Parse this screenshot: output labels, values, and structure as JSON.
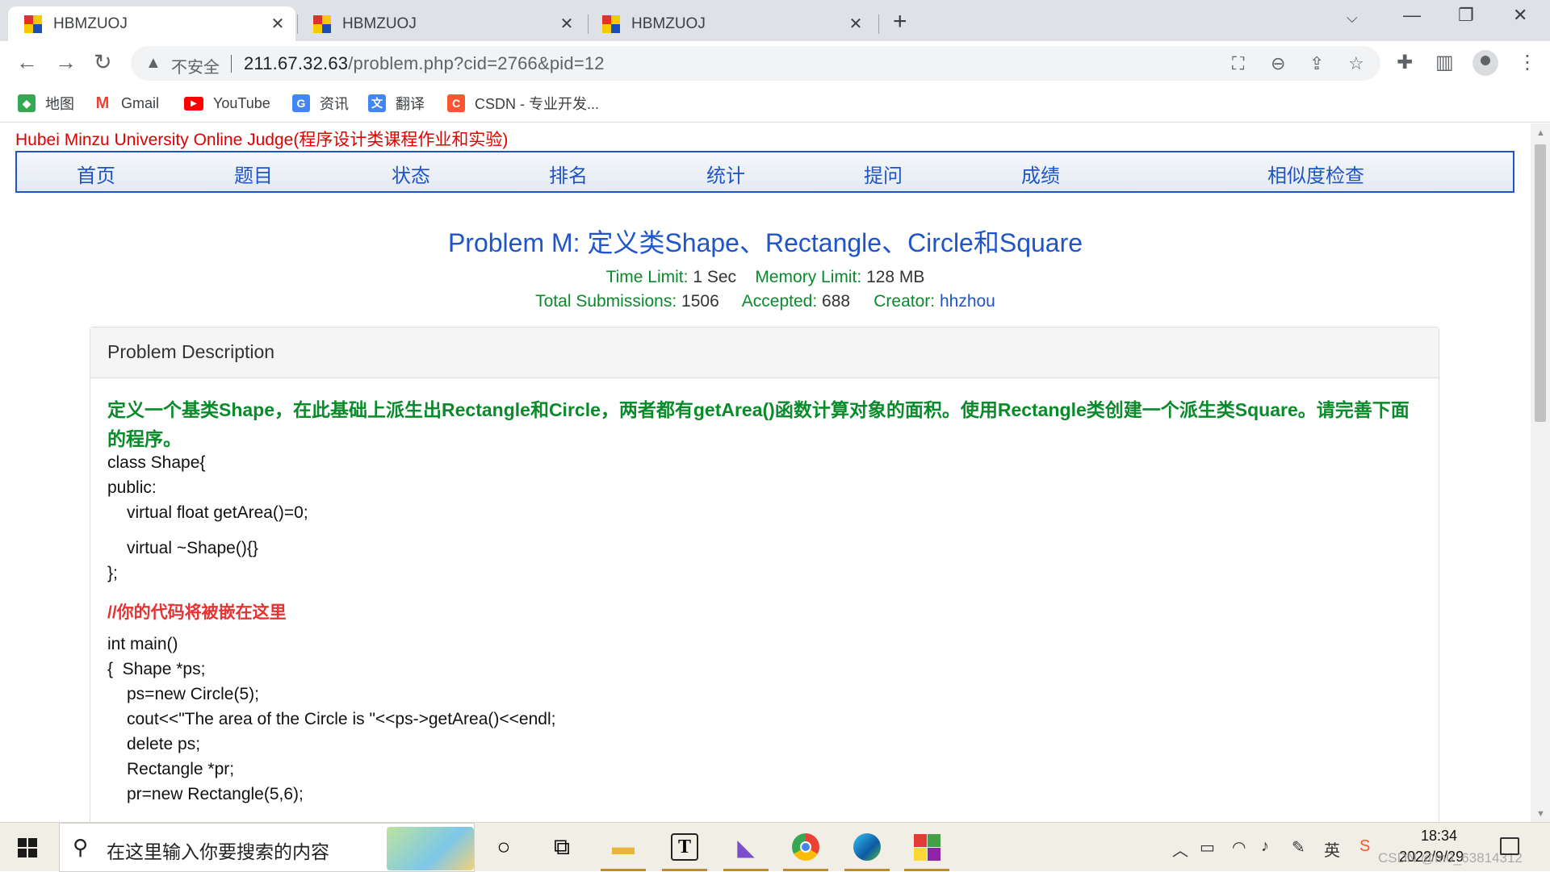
{
  "browser": {
    "tabs": [
      {
        "title": "HBMZUOJ"
      },
      {
        "title": "HBMZUOJ"
      },
      {
        "title": "HBMZUOJ"
      }
    ],
    "address": {
      "insecure_label": "不安全",
      "url_host": "211.67.32.63",
      "url_rest": "/problem.php?cid=2766&pid=12"
    },
    "bookmarks": [
      {
        "label": "地图",
        "color": "#34a853"
      },
      {
        "label": "Gmail",
        "color": "#ea4335"
      },
      {
        "label": "YouTube",
        "color": "#ff0000"
      },
      {
        "label": "资讯",
        "color": "#4285f4"
      },
      {
        "label": "翻译",
        "color": "#4285f4"
      },
      {
        "label": "CSDN - 专业开发...",
        "color": "#fc5531"
      }
    ]
  },
  "site": {
    "title": "Hubei Minzu University Online Judge(程序设计类课程作业和实验)",
    "nav": [
      "首页",
      "题目",
      "状态",
      "排名",
      "统计",
      "提问",
      "成绩",
      "相似度检查"
    ]
  },
  "problem": {
    "title": "Problem M: 定义类Shape、Rectangle、Circle和Square",
    "time_limit_label": "Time Limit:",
    "time_limit": "1 Sec",
    "memory_limit_label": "Memory Limit:",
    "memory_limit": "128 MB",
    "total_submissions_label": "Total Submissions:",
    "total_submissions": "1506",
    "accepted_label": "Accepted:",
    "accepted": "688",
    "creator_label": "Creator:",
    "creator": "hhzhou",
    "panel_heading": "Problem Description",
    "description": "定义一个基类Shape，在此基础上派生出Rectangle和Circle，两者都有getArea()函数计算对象的面积。使用Rectangle类创建一个派生类Square。请完善下面的程序。",
    "code_part1": [
      "class Shape{",
      "public:",
      "virtual float getArea()=0;",
      "virtual ~Shape(){}",
      "};"
    ],
    "note": "//你的代码将被嵌在这里",
    "code_part2": [
      "int main()",
      "{  Shape *ps;",
      "ps=new Circle(5);",
      "cout<<\"The area of the Circle is \"<<ps->getArea()<<endl;",
      "delete ps;",
      "Rectangle *pr;",
      "pr=new Rectangle(5,6);"
    ]
  },
  "taskbar": {
    "search_placeholder": "在这里输入你要搜索的内容",
    "time": "18:34",
    "date": "2022/9/29",
    "ime": "英",
    "watermark": "CSDN @m0_63814312"
  }
}
